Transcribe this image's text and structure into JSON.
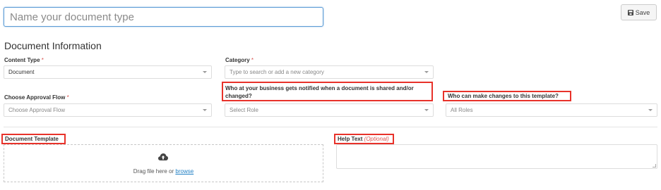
{
  "name_input": {
    "placeholder": "Name your document type"
  },
  "save_button": {
    "label": "Save",
    "icon": "floppy-disk-icon"
  },
  "section_title": "Document Information",
  "content_type": {
    "label": "Content Type",
    "required": "*",
    "value": "Document"
  },
  "category": {
    "label": "Category",
    "required": "*",
    "placeholder": "Type to search or add a new category"
  },
  "approval_flow": {
    "label": "Choose Approval Flow",
    "required": "*",
    "placeholder": "Choose Approval Flow"
  },
  "notify_role": {
    "label": "Who at your business gets notified when a document is shared and/or changed?",
    "value": "Select Role"
  },
  "change_role": {
    "label": "Who can make changes to this template?",
    "value": "All Roles"
  },
  "document_template": {
    "label": "Document Template",
    "drop_text": "Drag file here or",
    "browse_link": "browse",
    "icon": "cloud-upload-icon"
  },
  "help_text": {
    "label": "Help Text",
    "optional": "(Optional)"
  },
  "colors": {
    "highlight": "#e8322a",
    "required": "#d9534f",
    "link": "#1f7fc4",
    "input_focus": "#5b9bd5"
  }
}
